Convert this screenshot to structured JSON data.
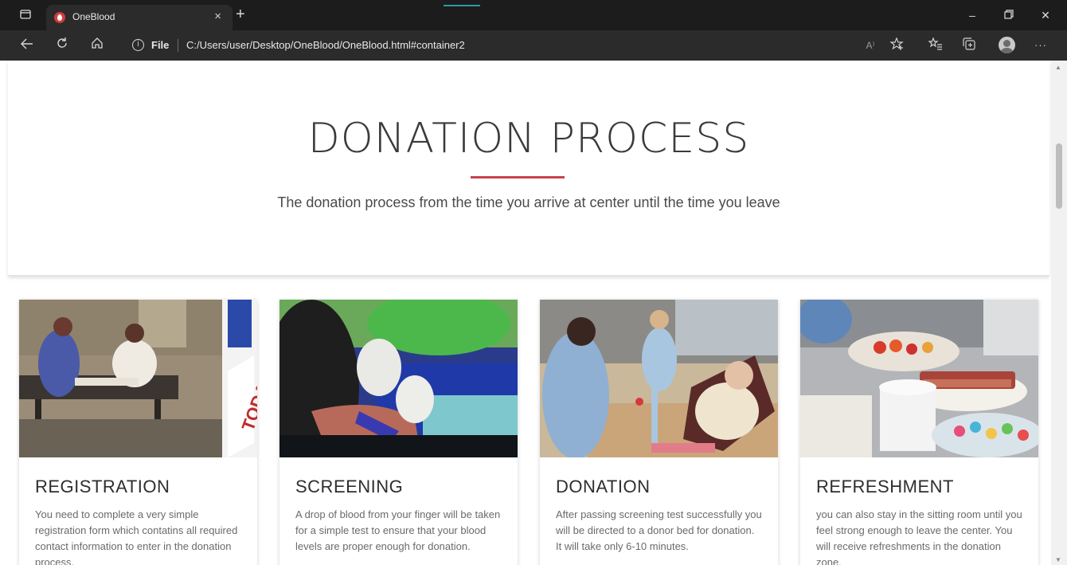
{
  "browser": {
    "tab_title": "OneBlood",
    "tab_close": "×",
    "new_tab": "+",
    "address": {
      "info_glyph": "i",
      "scheme_label": "File",
      "url": "C:/Users/user/Desktop/OneBlood/OneBlood.html#container2"
    },
    "window_controls": {
      "minimize": "–",
      "restore": "▢",
      "close": "✕"
    },
    "toolbar_icons": [
      "back-icon",
      "refresh-icon",
      "home-icon",
      "read-aloud-icon",
      "add-favorite-icon",
      "favorites-icon",
      "collections-icon",
      "profile-icon",
      "more-icon"
    ],
    "more_label": "···",
    "read_aloud_label": "A⁾"
  },
  "page": {
    "title": "DONATION PROCESS",
    "subtitle": "The donation process from the time you arrive at center until the time you leave",
    "accent_color": "#c9434c",
    "steps": [
      {
        "title": "REGISTRATION",
        "description": "You need to complete a very simple registration form which contatins all required contact information to enter in the donation process."
      },
      {
        "title": "SCREENING",
        "description": "A drop of blood from your finger will be taken for a simple test to ensure that your blood levels are proper enough for donation."
      },
      {
        "title": "DONATION",
        "description": "After passing screening test successfully you will be directed to a donor bed for donation. It will take only 6-10 minutes."
      },
      {
        "title": "REFRESHMENT",
        "description": "you can also stay in the sitting room until you feel strong enough to leave the center. You will receive refreshments in the donation zone."
      }
    ]
  }
}
